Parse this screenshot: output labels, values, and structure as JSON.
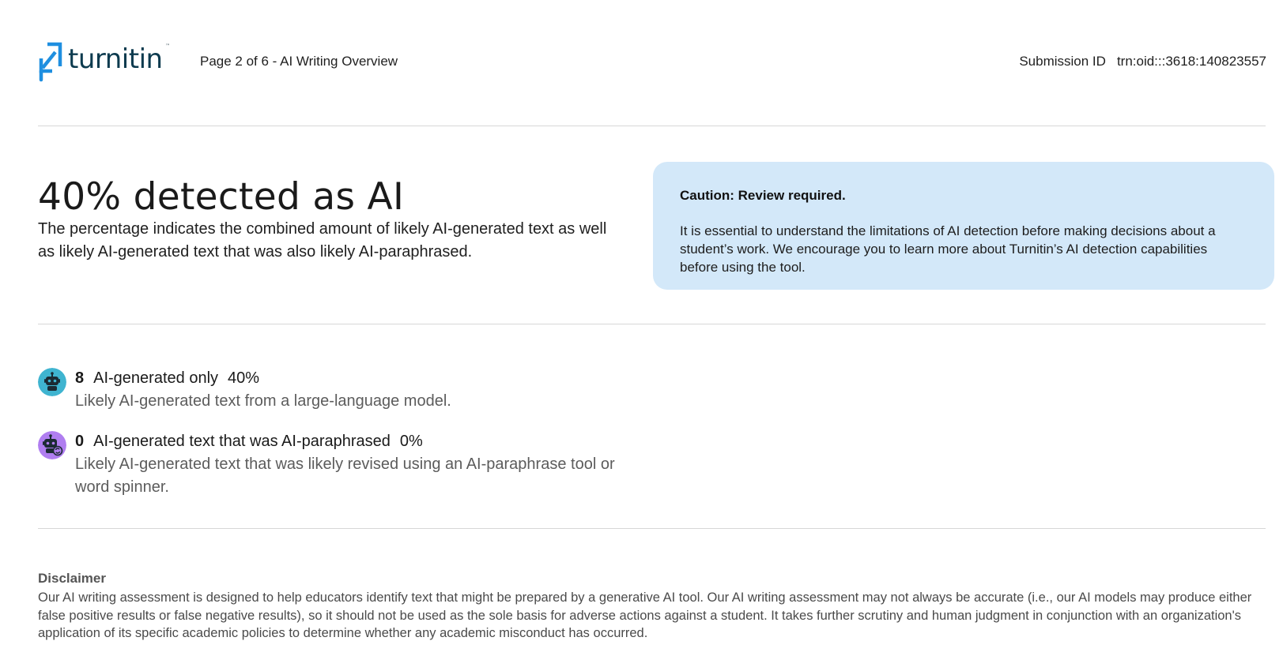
{
  "header": {
    "brand": "turnitin",
    "page_label": "Page 2 of 6 - AI Writing Overview",
    "submission_label": "Submission ID",
    "submission_id": "trn:oid:::3618:140823557"
  },
  "summary": {
    "headline": "40% detected as AI",
    "description": "The percentage indicates the combined amount of likely AI-generated text as well as likely AI-generated text that was also likely AI-paraphrased."
  },
  "caution": {
    "title": "Caution: Review required.",
    "body": "It is essential to understand the limitations of AI detection before making decisions about a student’s work. We encourage you to learn more about Turnitin’s AI detection capabilities before using the tool."
  },
  "categories": [
    {
      "count": "8",
      "label": "AI-generated only",
      "percent": "40%",
      "description": "Likely AI-generated text from a large-language model.",
      "icon": "robot-icon",
      "color": "#3fb4d0"
    },
    {
      "count": "0",
      "label": "AI-generated text that was AI-paraphrased",
      "percent": "0%",
      "description": "Likely AI-generated text that was likely revised using an AI-paraphrase tool or word spinner.",
      "icon": "robot-paraphrase-icon",
      "color": "#b07ef0"
    }
  ],
  "disclaimer": {
    "title": "Disclaimer",
    "body": "Our AI writing assessment is designed to help educators identify text that might be prepared by a generative AI tool. Our AI writing assessment may not always be accurate (i.e., our AI models may produce either false positive results or false negative results), so it should not be used as the sole basis for adverse actions against a student. It takes further scrutiny and human judgment in conjunction with an organization's application of its specific academic policies to determine whether any academic misconduct has occurred."
  },
  "colors": {
    "brand_blue": "#1f8fe0",
    "brand_text": "#0d3b4f",
    "caution_bg": "#d3e8f9",
    "divider": "#d7d7d7"
  }
}
